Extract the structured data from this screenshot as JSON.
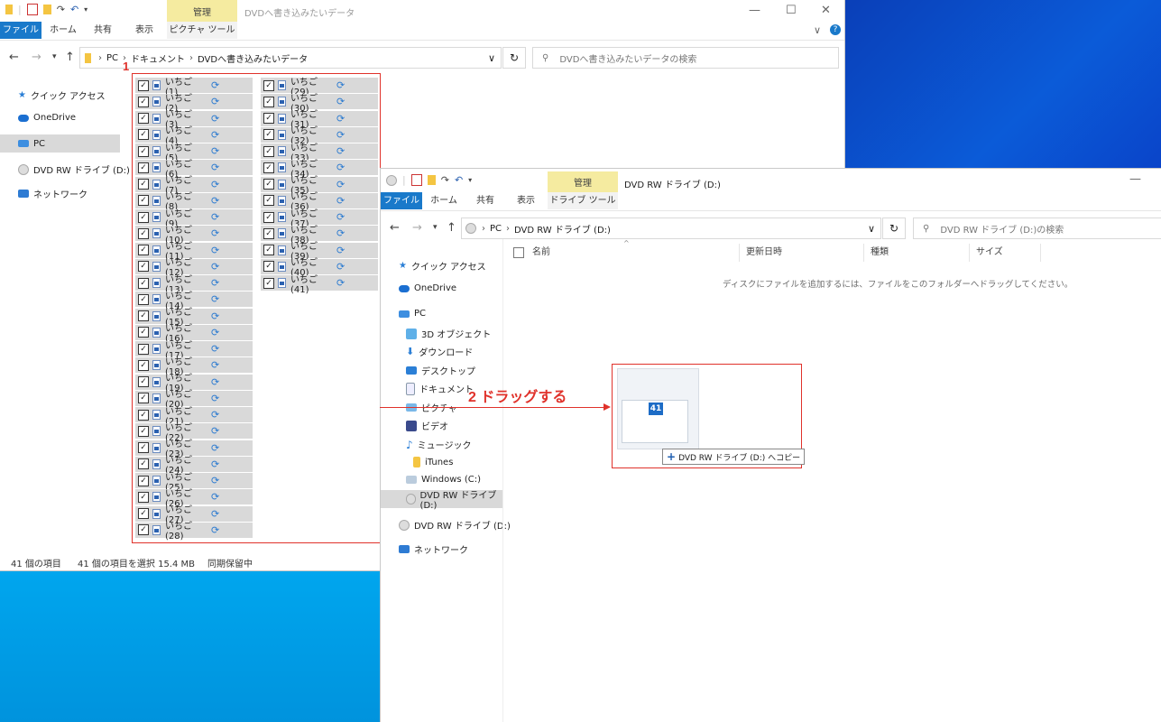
{
  "window1": {
    "title": "DVDへ書き込みたいデータ",
    "manage_tab": "管理",
    "ribbon_tabs": [
      "ファイル",
      "ホーム",
      "共有",
      "表示",
      "ピクチャ ツール"
    ],
    "breadcrumb": [
      "PC",
      "ドキュメント",
      "DVDへ書き込みたいデータ"
    ],
    "search_placeholder": "DVDへ書き込みたいデータの検索",
    "nav": [
      "クイック アクセス",
      "OneDrive",
      "PC",
      "DVD RW ドライブ (D:)",
      "ネットワーク"
    ],
    "files_col1": [
      "いちご (1)",
      "いちご (2)",
      "いちご (3)",
      "いちご (4)",
      "いちご (5)",
      "いちご (6)",
      "いちご (7)",
      "いちご (8)",
      "いちご (9)",
      "いちご (10)",
      "いちご (11)",
      "いちご (12)",
      "いちご (13)",
      "いちご (14)",
      "いちご (15)",
      "いちご (16)",
      "いちご (17)",
      "いちご (18)",
      "いちご (19)",
      "いちご (20)",
      "いちご (21)",
      "いちご (22)",
      "いちご (23)",
      "いちご (24)",
      "いちご (25)",
      "いちご (26)",
      "いちご (27)",
      "いちご (28)"
    ],
    "files_col2": [
      "いちご (29)",
      "いちご (30)",
      "いちご (31)",
      "いちご (32)",
      "いちご (33)",
      "いちご (34)",
      "いちご (35)",
      "いちご (36)",
      "いちご (37)",
      "いちご (38)",
      "いちご (39)",
      "いちご (40)",
      "いちご (41)"
    ],
    "status": {
      "count": "41 個の項目",
      "selected": "41 個の項目を選択  15.4 MB",
      "sync": "同期保留中"
    }
  },
  "window2": {
    "title": "DVD RW ドライブ (D:)",
    "manage_tab": "管理",
    "ribbon_tabs": [
      "ファイル",
      "ホーム",
      "共有",
      "表示",
      "ドライブ ツール"
    ],
    "breadcrumb": [
      "PC",
      "DVD RW ドライブ (D:)"
    ],
    "search_placeholder": "DVD RW ドライブ (D:)の検索",
    "columns": [
      "名前",
      "更新日時",
      "種類",
      "サイズ"
    ],
    "empty_message": "ディスクにファイルを追加するには、ファイルをこのフォルダーへドラッグしてください。",
    "nav": [
      "クイック アクセス",
      "OneDrive",
      "PC",
      "3D オブジェクト",
      "ダウンロード",
      "デスクトップ",
      "ドキュメント",
      "ピクチャ",
      "ビデオ",
      "ミュージック",
      "iTunes",
      "Windows (C:)",
      "DVD RW ドライブ (D:)",
      "DVD RW ドライブ (D:)",
      "ネットワーク"
    ],
    "drag_count": "41",
    "drag_tooltip": "DVD RW ドライブ (D:) へコピー"
  },
  "annotations": {
    "step1": "1",
    "step2": "2 ドラッグする"
  },
  "colors": {
    "accent": "#1979ca",
    "annotation": "#e0322b",
    "manage_tab": "#f5eba0"
  }
}
